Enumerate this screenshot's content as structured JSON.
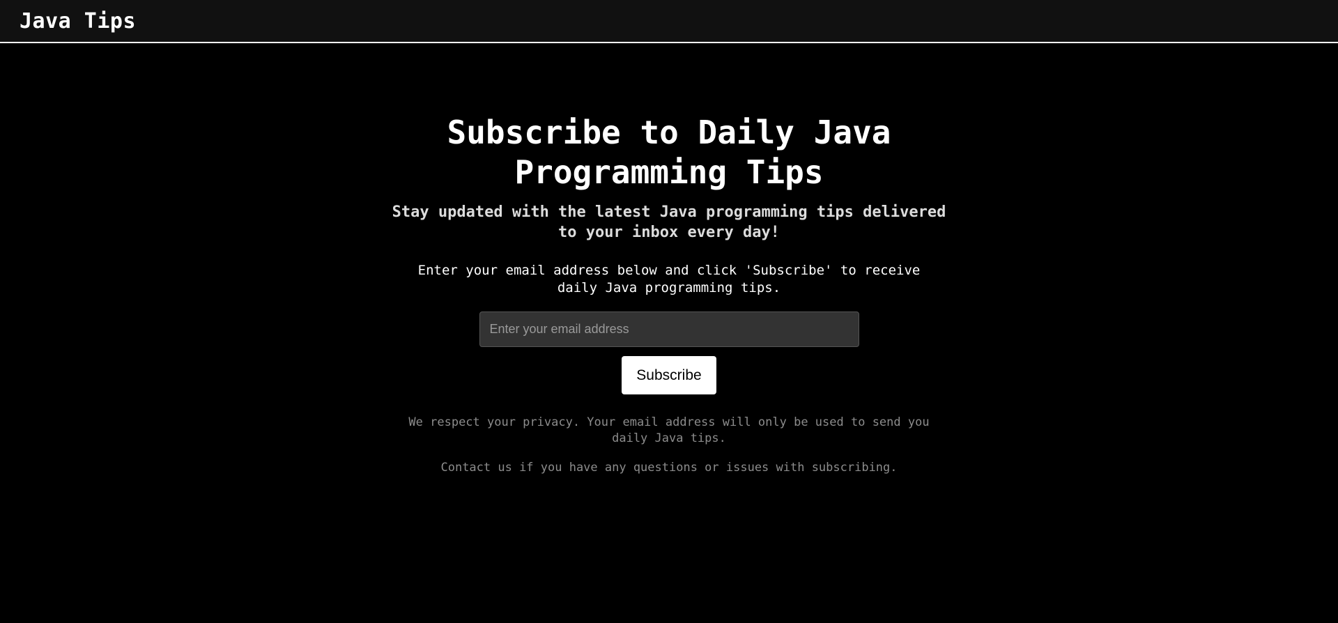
{
  "header": {
    "title": "Java Tips"
  },
  "main": {
    "headline": "Subscribe to Daily Java Programming Tips",
    "subheadline": "Stay updated with the latest Java programming tips delivered to your inbox every day!",
    "instructions": "Enter your email address below and click 'Subscribe' to receive daily Java programming tips.",
    "form": {
      "email_placeholder": "Enter your email address",
      "email_value": "",
      "subscribe_label": "Subscribe"
    },
    "privacy_note": "We respect your privacy. Your email address will only be used to send you daily Java tips.",
    "contact_note": "Contact us if you have any questions or issues with subscribing."
  },
  "colors": {
    "background": "#000000",
    "header_background": "#111111",
    "text": "#ffffff",
    "muted_text": "#8c8c8c",
    "input_background": "#333333",
    "button_background": "#ffffff"
  }
}
